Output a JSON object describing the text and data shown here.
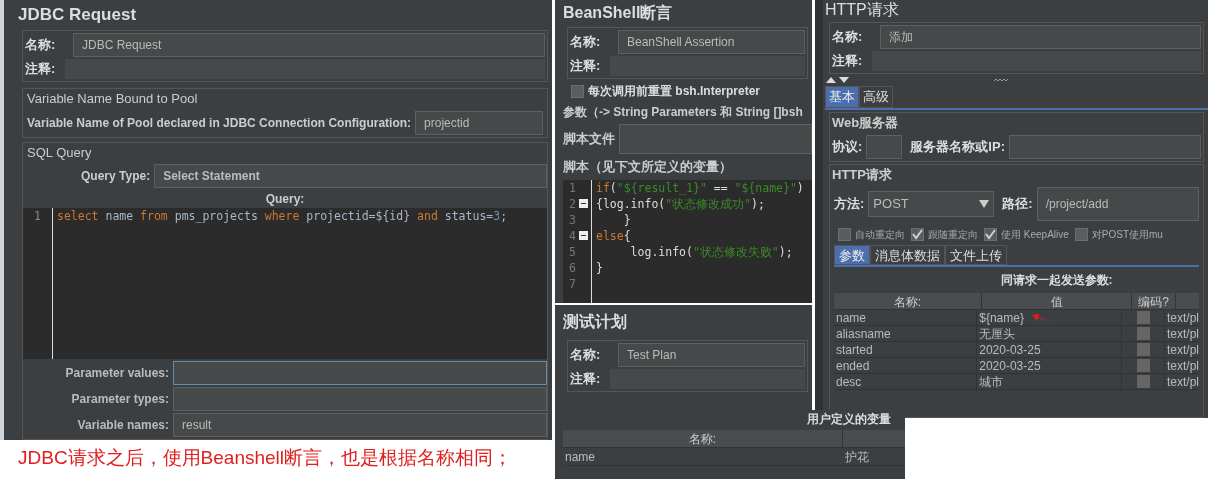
{
  "jdbc": {
    "title": "JDBC Request",
    "name_label": "名称:",
    "name_value": "JDBC Request",
    "comment_label": "注释:",
    "pool_group": "Variable Name Bound to Pool",
    "pool_label": "Variable Name of Pool declared in JDBC Connection Configuration:",
    "pool_value": "projectid",
    "sql_group": "SQL Query",
    "query_type_label": "Query Type:",
    "query_type_value": "Select Statement",
    "query_label": "Query:",
    "code": [
      {
        "number": "1",
        "tokens": [
          {
            "text": "select",
            "kind": "keyword"
          },
          {
            "text": " name ",
            "kind": "plain"
          },
          {
            "text": "from",
            "kind": "keyword"
          },
          {
            "text": " pms_projects ",
            "kind": "plain"
          },
          {
            "text": "where",
            "kind": "keyword"
          },
          {
            "text": " projectid=${id} ",
            "kind": "plain"
          },
          {
            "text": "and",
            "kind": "keyword"
          },
          {
            "text": " status=",
            "kind": "plain"
          },
          {
            "text": "3",
            "kind": "number"
          },
          {
            "text": ";",
            "kind": "plain"
          }
        ]
      }
    ],
    "params": [
      {
        "label": "Parameter values:",
        "focused": true
      },
      {
        "label": "Parameter types:",
        "focused": false
      },
      {
        "label": "Variable names:",
        "value": "result",
        "focused": false
      }
    ]
  },
  "caption": "JDBC请求之后，使用Beanshell断言，也是根据名称相同；",
  "beanshell": {
    "title": "BeanShell断言",
    "name_label": "名称:",
    "name_value": "BeanShell Assertion",
    "comment_label": "注释:",
    "reset": {
      "label": "每次调用前重置",
      "suffix": "bsh.Interpreter",
      "checked": false
    },
    "params_label": "参数（-> String Parameters 和 String []bsh",
    "file_label": "脚本文件",
    "script_label": "脚本（见下文所定义的变量）",
    "code": [
      {
        "number": "1",
        "foldable": false,
        "tokens": [
          {
            "text": "if",
            "kind": "keyword"
          },
          {
            "text": "(",
            "kind": "plain"
          },
          {
            "text": "\"${result_1}\"",
            "kind": "string"
          },
          {
            "text": " == ",
            "kind": "plain"
          },
          {
            "text": "\"${name}\"",
            "kind": "string"
          },
          {
            "text": ")",
            "kind": "plain"
          }
        ]
      },
      {
        "number": "2",
        "foldable": true,
        "tokens": [
          {
            "text": "{log.info(",
            "kind": "plain"
          },
          {
            "text": "\"状态修改成功\"",
            "kind": "string"
          },
          {
            "text": ");",
            "kind": "plain"
          }
        ]
      },
      {
        "number": "3",
        "foldable": false,
        "tokens": [
          {
            "text": "    }",
            "kind": "plain"
          }
        ]
      },
      {
        "number": "4",
        "foldable": true,
        "tokens": [
          {
            "text": "else",
            "kind": "keyword"
          },
          {
            "text": "{",
            "kind": "plain"
          }
        ]
      },
      {
        "number": "5",
        "foldable": false,
        "tokens": [
          {
            "text": "     log.info(",
            "kind": "plain"
          },
          {
            "text": "\"状态修改失败\"",
            "kind": "string"
          },
          {
            "text": ");",
            "kind": "plain"
          }
        ]
      },
      {
        "number": "6",
        "foldable": false,
        "tokens": [
          {
            "text": "}",
            "kind": "plain"
          }
        ]
      },
      {
        "number": "7",
        "foldable": false
      }
    ]
  },
  "test_plan": {
    "title": "测试计划",
    "name_label": "名称:",
    "name_value": "Test Plan",
    "comment_label": "注释:",
    "table_title": "用户定义的变量",
    "columns": [
      "名称:"
    ],
    "rows": [
      [
        "name",
        "护花"
      ]
    ]
  },
  "http": {
    "title": "HTTP请求",
    "name_label": "名称:",
    "name_value": "添加",
    "comment_label": "注释:",
    "tabs": [
      {
        "label": "基本",
        "selected": true
      },
      {
        "label": "高级",
        "selected": false
      }
    ],
    "web_group": "Web服务器",
    "protocol_label": "协议:",
    "server_label": "服务器名称或IP:",
    "request_group": "HTTP请求",
    "method_label": "方法:",
    "method_value": "POST",
    "path_label": "路径:",
    "path_value": "/project/add",
    "options": [
      {
        "label": "自动重定向",
        "checked": false
      },
      {
        "label": "跟随重定向",
        "checked": true
      },
      {
        "label": "使用 KeepAlive",
        "checked": true
      },
      {
        "label": "对POST使用mu",
        "checked": false
      }
    ],
    "subtabs": [
      {
        "label": "参数",
        "selected": true
      },
      {
        "label": "消息体数据",
        "selected": false
      },
      {
        "label": "文件上传",
        "selected": false
      }
    ],
    "table_title": "同请求一起发送参数:",
    "columns": [
      "名称:",
      "值",
      "编码?"
    ],
    "rows": [
      {
        "name": "name",
        "value": "${name}",
        "encode": false,
        "column_4": "text/pl",
        "marked": true
      },
      {
        "name": "aliasname",
        "value": "无厘头",
        "encode": false,
        "column_4": "text/pl",
        "marked": false
      },
      {
        "name": "started",
        "value": "2020-03-25",
        "encode": false,
        "column_4": "text/pl",
        "marked": false
      },
      {
        "name": "ended",
        "value": "2020-03-25",
        "encode": false,
        "column_4": "text/pl",
        "marked": false
      },
      {
        "name": "desc",
        "value": "城市",
        "encode": false,
        "column_4": "text/pl",
        "marked": false
      }
    ]
  }
}
